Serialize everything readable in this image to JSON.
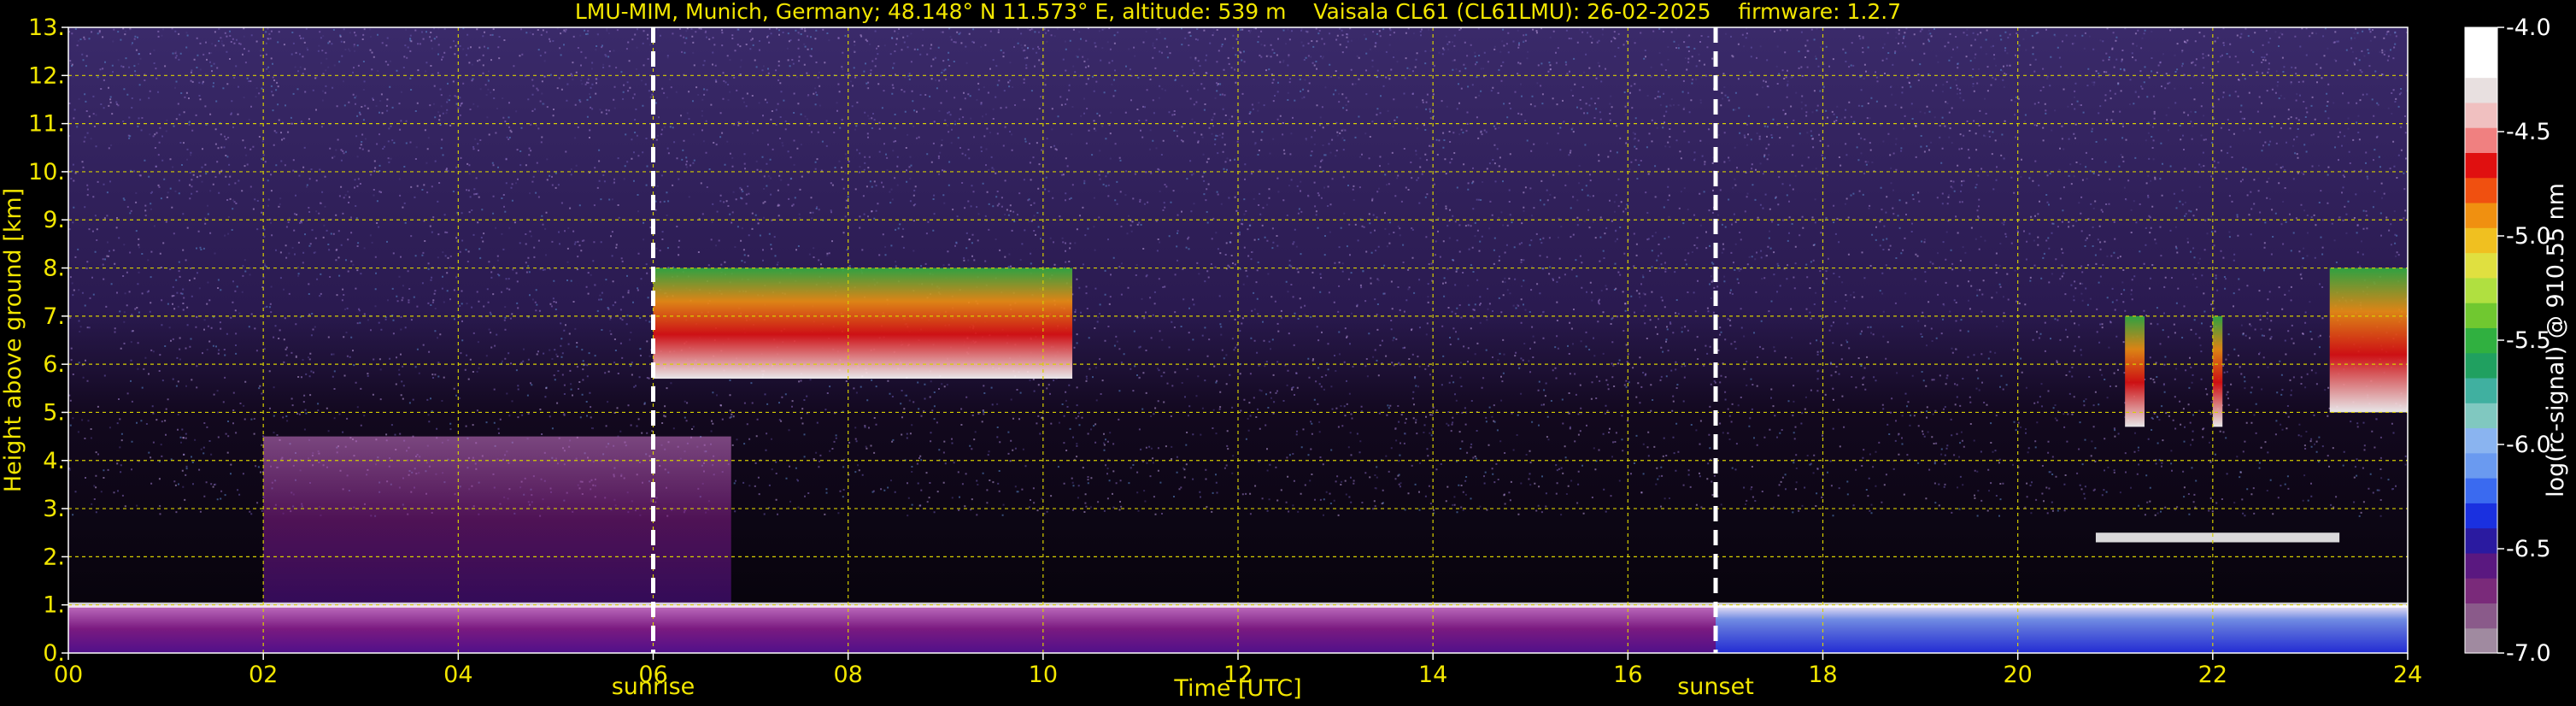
{
  "chart_data": {
    "type": "heatmap",
    "title": "LMU-MIM, Munich, Germany; 48.148° N 11.573° E, altitude: 539 m    Vaisala CL61 (CL61LMU): 26-02-2025    firmware: 1.2.7",
    "xlabel": "Time [UTC]",
    "ylabel": "Height above ground [km]",
    "xlim": [
      0,
      24
    ],
    "ylim": [
      0,
      13
    ],
    "x_ticks": [
      "00",
      "02",
      "04",
      "06",
      "08",
      "10",
      "12",
      "14",
      "16",
      "18",
      "20",
      "22",
      "24"
    ],
    "y_ticks": [
      "0.",
      "1.",
      "2.",
      "3.",
      "4.",
      "5.",
      "6.",
      "7.",
      "8.",
      "9.",
      "10.",
      "11.",
      "12.",
      "13."
    ],
    "grid": true,
    "markers": [
      {
        "label": "sunrise",
        "x": 6.0
      },
      {
        "label": "sunset",
        "x": 16.9
      }
    ],
    "colorbar": {
      "label": "log(rc-signal) @ 910.55 nm",
      "range": [
        -7.0,
        -4.0
      ],
      "ticks": [
        "-4.0",
        "-4.5",
        "-5.0",
        "-5.5",
        "-6.0",
        "-6.5",
        "-7.0"
      ],
      "colors": [
        "#a08aa0",
        "#8a5a8a",
        "#7a2a7a",
        "#5a1880",
        "#2a1aa0",
        "#1a30e0",
        "#3a6af0",
        "#6a9af0",
        "#8ab4f0",
        "#80c8c0",
        "#40b0a0",
        "#20a060",
        "#30b040",
        "#70c830",
        "#b0e040",
        "#e0e040",
        "#f0c020",
        "#f09010",
        "#f05010",
        "#e01010",
        "#f08080",
        "#f0c0c0",
        "#e8e0e0",
        "#ffffff",
        "#ffffff"
      ]
    },
    "features": [
      {
        "name": "boundary layer",
        "x_range": [
          0,
          24
        ],
        "height_km": [
          0,
          1.0
        ]
      },
      {
        "name": "aerosol/cloud plume",
        "x_range": [
          2.0,
          6.8
        ],
        "height_km": [
          1.0,
          4.5
        ]
      },
      {
        "name": "mid-level cloud",
        "x_range": [
          6.0,
          10.3
        ],
        "height_km": [
          5.7,
          8.0
        ]
      },
      {
        "name": "cloud",
        "x_range": [
          21.1,
          21.3
        ],
        "height_km": [
          4.7,
          7.0
        ]
      },
      {
        "name": "cloud",
        "x_range": [
          22.0,
          22.1
        ],
        "height_km": [
          4.7,
          7.0
        ]
      },
      {
        "name": "cloud",
        "x_range": [
          23.2,
          24
        ],
        "height_km": [
          5.0,
          8.0
        ]
      },
      {
        "name": "low cloud layer",
        "x_range": [
          20.8,
          23.3
        ],
        "height_km": [
          2.3,
          2.5
        ]
      }
    ]
  }
}
